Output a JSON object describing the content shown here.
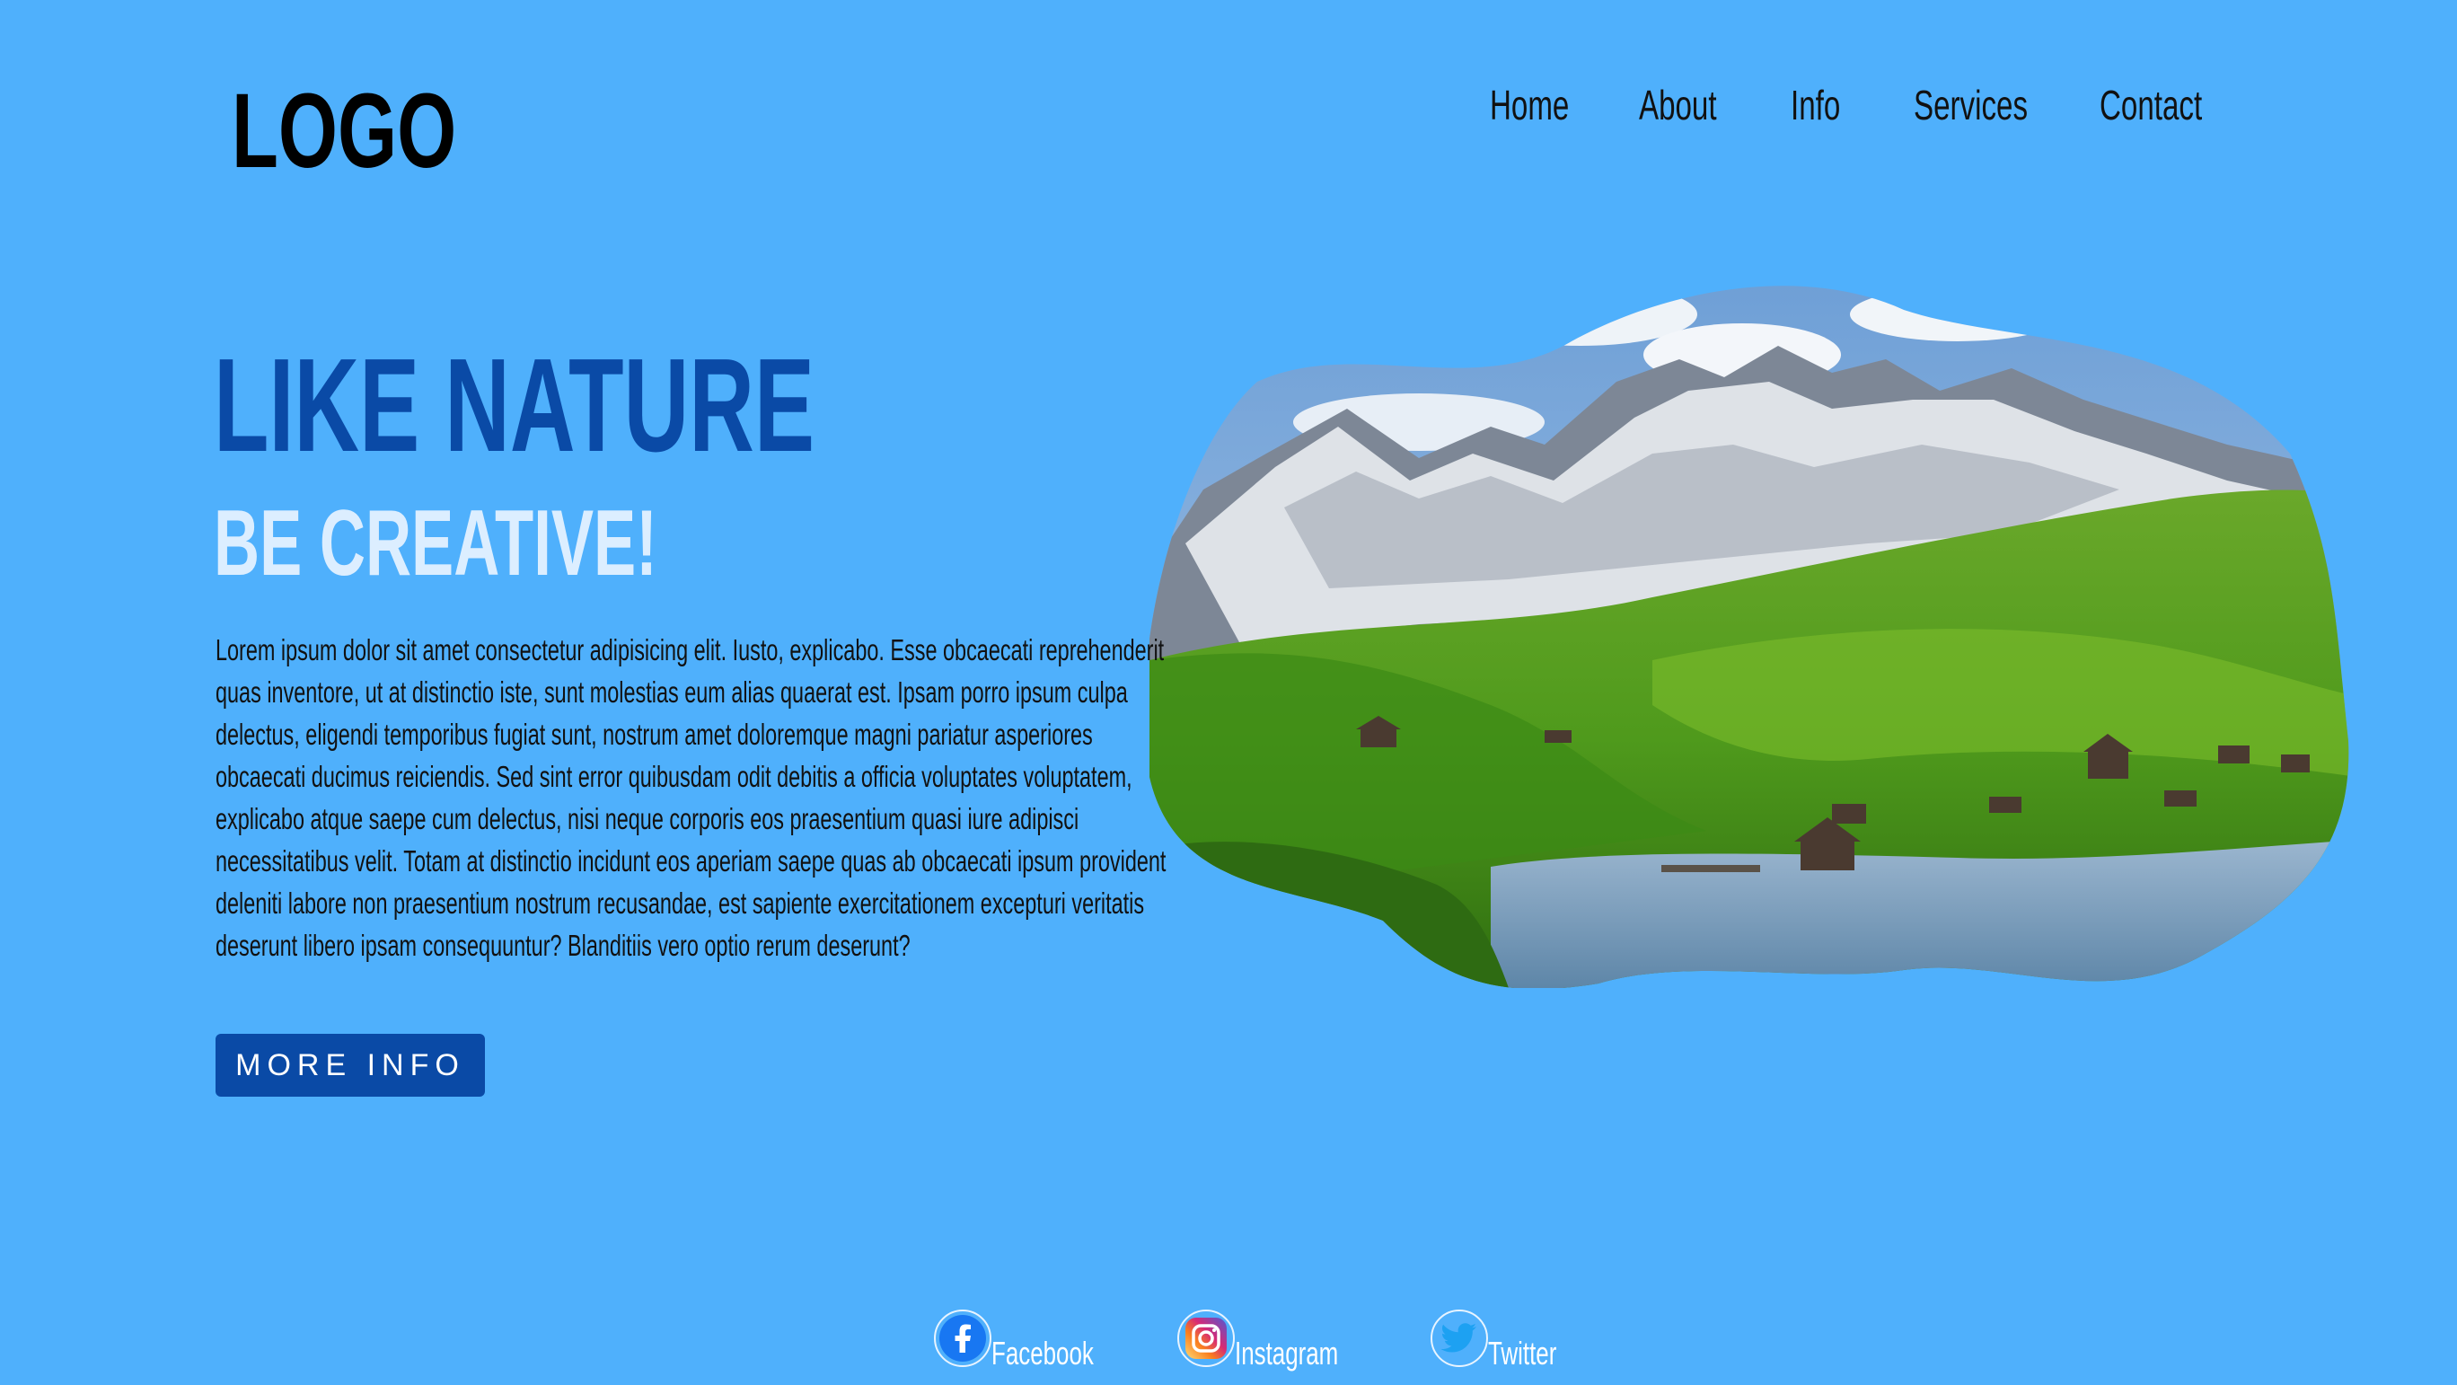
{
  "header": {
    "logo_text": "LOGO",
    "nav": [
      {
        "label": "Home"
      },
      {
        "label": "About"
      },
      {
        "label": "Info"
      },
      {
        "label": "Services"
      },
      {
        "label": "Contact"
      }
    ]
  },
  "hero": {
    "headline": "LIKE NATURE",
    "subheadline": "BE CREATIVE!",
    "body_lines": [
      "Lorem ipsum dolor sit amet consectetur adipisicing elit. Iusto, explicabo. Esse obcaecati reprehenderit",
      "quas inventore, ut at distinctio iste, sunt molestias eum alias quaerat est. Ipsam porro ipsum culpa",
      "delectus, eligendi temporibus fugiat sunt, nostrum amet doloremque magni pariatur asperiores",
      "obcaecati ducimus reiciendis. Sed sint error quibusdam odit debitis a officia voluptates voluptatem,",
      "explicabo atque saepe cum delectus, nisi neque corporis eos praesentium quasi iure adipisci",
      "necessitatibus velit. Totam at distinctio incidunt eos aperiam saepe quas ab obcaecati ipsum provident",
      "deleniti labore non praesentium nostrum recusandae, est sapiente exercitationem excepturi veritatis",
      "deserunt libero ipsam consequuntur? Blanditiis vero optio rerum deserunt?"
    ],
    "button_label": "MORE INFO",
    "image": "mountain-lake-landscape"
  },
  "social": [
    {
      "label": "Facebook",
      "icon": "facebook-icon"
    },
    {
      "label": "Instagram",
      "icon": "instagram-icon"
    },
    {
      "label": "Twitter",
      "icon": "twitter-icon"
    }
  ],
  "colors": {
    "background": "#4fb0fc",
    "accent": "#0a4aa6",
    "subheadline": "#dceeff"
  }
}
